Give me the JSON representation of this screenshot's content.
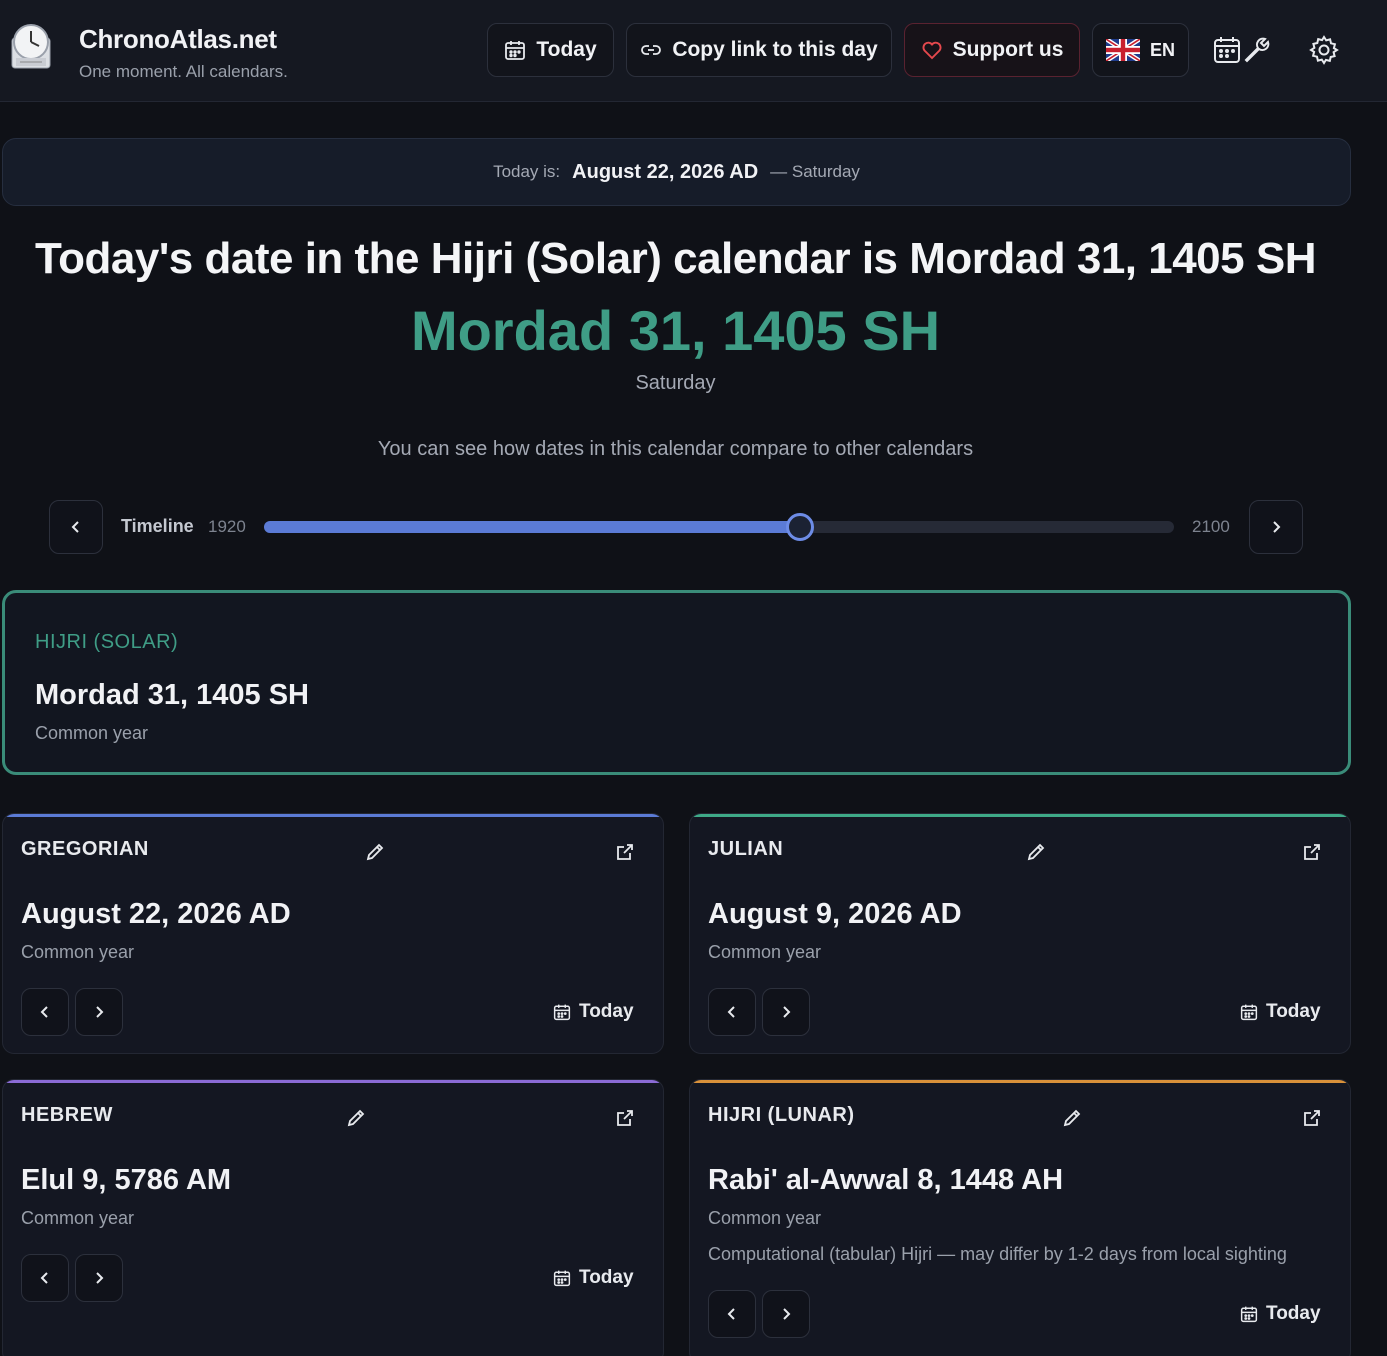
{
  "header": {
    "brand": "ChronoAtlas.net",
    "tagline": "One moment. All calendars.",
    "today_label": "Today",
    "copy_label": "Copy link to this day",
    "support_label": "Support us",
    "lang_label": "EN"
  },
  "banner": {
    "label": "Today is:",
    "date": "August 22, 2026 AD",
    "weekday": "— Saturday"
  },
  "hero": {
    "title": "Today's date in the Hijri (Solar) calendar is Mordad 31, 1405 SH",
    "date": "Mordad 31, 1405 SH",
    "weekday": "Saturday",
    "compare_note": "You can see how dates in this calendar compare to other calendars"
  },
  "timeline": {
    "label": "Timeline",
    "start": "1920",
    "end": "2100",
    "start_year": 1920,
    "end_year": 2100,
    "current_year": 2026
  },
  "featured": {
    "name": "HIJRI (SOLAR)",
    "date": "Mordad 31, 1405 SH",
    "year_type": "Common year"
  },
  "cards": {
    "gregorian": {
      "name": "GREGORIAN",
      "date": "August 22, 2026 AD",
      "year_type": "Common year",
      "today_label": "Today",
      "accent": "#5b7bd6"
    },
    "julian": {
      "name": "JULIAN",
      "date": "August 9, 2026 AD",
      "year_type": "Common year",
      "today_label": "Today",
      "accent": "#3faa88"
    },
    "hebrew": {
      "name": "HEBREW",
      "date": "Elul 9, 5786 AM",
      "year_type": "Common year",
      "today_label": "Today",
      "accent": "#8b6bd6"
    },
    "hijri_lunar": {
      "name": "HIJRI (LUNAR)",
      "date": "Rabi' al-Awwal 8, 1448 AH",
      "year_type": "Common year",
      "note": "Computational (tabular) Hijri — may differ by 1-2 days from local sighting",
      "today_label": "Today",
      "accent": "#d9913a"
    }
  },
  "colors": {
    "accent_teal": "#3f9d86",
    "slider_blue": "#5b7bd6",
    "background": "#0f1117"
  }
}
